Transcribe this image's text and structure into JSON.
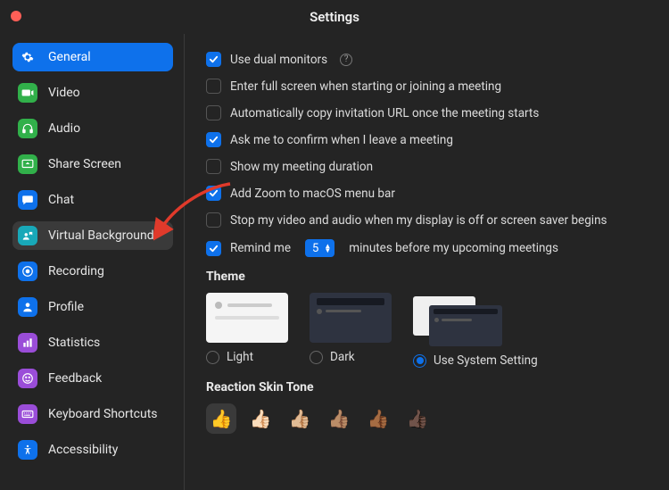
{
  "title": "Settings",
  "accent": "#0e71eb",
  "sidebar": {
    "items": [
      {
        "label": "General",
        "icon": "gear",
        "color": "#ffffff",
        "state": "active"
      },
      {
        "label": "Video",
        "icon": "video",
        "color": "#31b04a",
        "state": "normal"
      },
      {
        "label": "Audio",
        "icon": "headphone",
        "color": "#31b04a",
        "state": "normal"
      },
      {
        "label": "Share Screen",
        "icon": "screen",
        "color": "#31b04a",
        "state": "normal"
      },
      {
        "label": "Chat",
        "icon": "chat",
        "color": "#0e71eb",
        "state": "normal"
      },
      {
        "label": "Virtual Background",
        "icon": "vb",
        "color": "#18a8b8",
        "state": "hover"
      },
      {
        "label": "Recording",
        "icon": "record",
        "color": "#0e71eb",
        "state": "normal"
      },
      {
        "label": "Profile",
        "icon": "profile",
        "color": "#0e71eb",
        "state": "normal"
      },
      {
        "label": "Statistics",
        "icon": "stats",
        "color": "#9a4dd8",
        "state": "normal"
      },
      {
        "label": "Feedback",
        "icon": "smile",
        "color": "#9a4dd8",
        "state": "normal"
      },
      {
        "label": "Keyboard Shortcuts",
        "icon": "keyboard",
        "color": "#9a4dd8",
        "state": "normal"
      },
      {
        "label": "Accessibility",
        "icon": "access",
        "color": "#0e71eb",
        "state": "normal"
      }
    ]
  },
  "checkboxes": [
    {
      "label": "Use dual monitors",
      "checked": true,
      "help": true
    },
    {
      "label": "Enter full screen when starting or joining a meeting",
      "checked": false
    },
    {
      "label": "Automatically copy invitation URL once the meeting starts",
      "checked": false
    },
    {
      "label": "Ask me to confirm when I leave a meeting",
      "checked": true
    },
    {
      "label": "Show my meeting duration",
      "checked": false
    },
    {
      "label": "Add Zoom to macOS menu bar",
      "checked": true
    },
    {
      "label": "Stop my video and audio when my display is off or screen saver begins",
      "checked": false
    }
  ],
  "remind": {
    "checked": true,
    "before": "Remind me",
    "value": "5",
    "after": "minutes before my upcoming meetings"
  },
  "theme": {
    "title": "Theme",
    "options": [
      {
        "label": "Light",
        "selected": false,
        "variant": "light"
      },
      {
        "label": "Dark",
        "selected": false,
        "variant": "dark"
      },
      {
        "label": "Use System Setting",
        "selected": true,
        "variant": "system"
      }
    ]
  },
  "skin": {
    "title": "Reaction Skin Tone",
    "tones": [
      "👍",
      "👍🏻",
      "👍🏼",
      "👍🏽",
      "👍🏾",
      "👍🏿"
    ],
    "selected_index": 0
  }
}
